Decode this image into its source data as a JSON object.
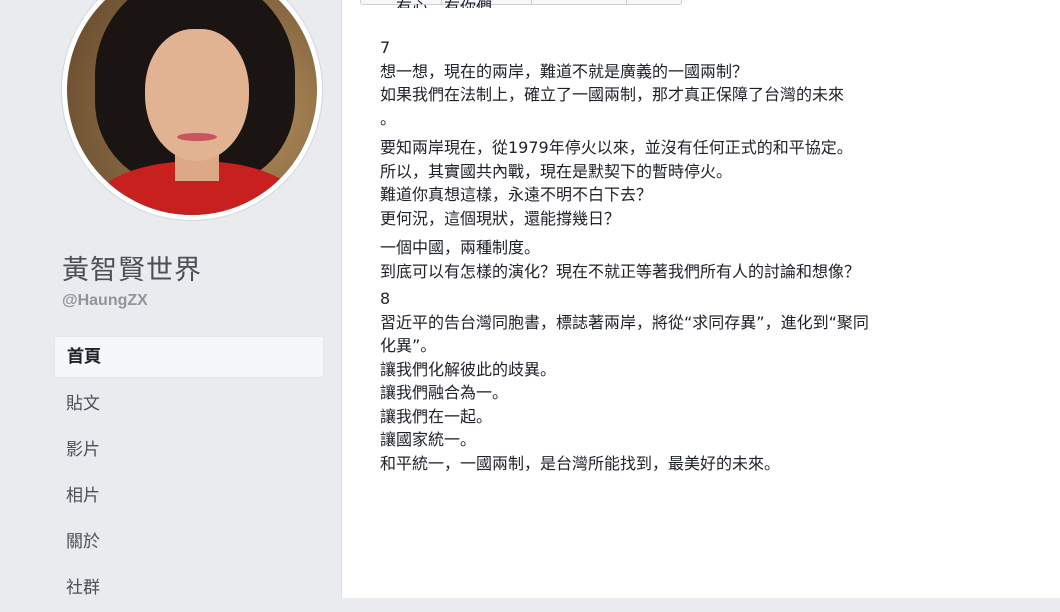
{
  "page": {
    "name": "黃智賢世界",
    "handle": "@HaungZX"
  },
  "nav": [
    {
      "label": "首頁",
      "active": true
    },
    {
      "label": "貼文"
    },
    {
      "label": "影片"
    },
    {
      "label": "相片"
    },
    {
      "label": "關於"
    },
    {
      "label": "社群"
    }
  ],
  "post": {
    "cut_line": "。有心，有你們",
    "section7": {
      "number": "7",
      "lines": [
        "想一想，現在的兩岸，難道不就是廣義的一國兩制？",
        "如果我們在法制上，確立了一國兩制，那才真正保障了台灣的未來",
        "。",
        "要知兩岸現在，從1979年停火以來，並沒有任何正式的和平協定。",
        "所以，其實國共內戰，現在是默契下的暫時停火。",
        "難道你真想這樣，永遠不明不白下去？",
        "更何況，這個現狀，還能撐幾日？",
        "一個中國，兩種制度。",
        "到底可以有怎樣的演化？現在不就正等著我們所有人的討論和想像？"
      ]
    },
    "section8": {
      "number": "8",
      "lines": [
        "習近平的告台灣同胞書，標誌著兩岸，將從“求同存異”，進化到“聚同",
        "化異”。",
        "讓我們化解彼此的歧異。",
        "讓我們融合為一。",
        "讓我們在一起。",
        "讓國家統一。",
        "和平統一，一國兩制，是台灣所能找到，最美好的未來。"
      ]
    }
  }
}
